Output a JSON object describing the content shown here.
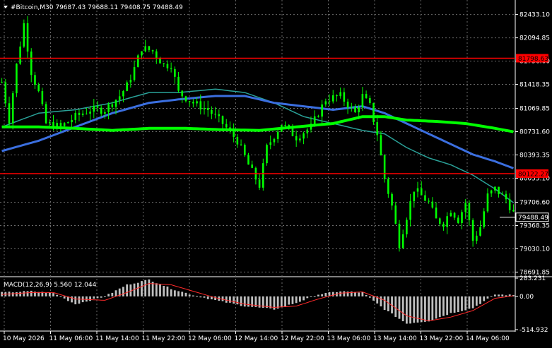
{
  "header": {
    "symbol_line": "#Bitcoin,M30  79687.43 79688.11 79408.75 79488.49"
  },
  "colors": {
    "background": "#000000",
    "candle": "#00ff00",
    "grid": "#6a6a6a",
    "axis_text": "#ffffff",
    "hline": "#ff0000",
    "hline_label_bg": "#ff0000",
    "ma_fast": "#2aa198",
    "ma_mid": "#3b6fe0",
    "ma_slow": "#00ff00",
    "macd_hist": "#c0c0c0",
    "macd_signal": "#ff2a2a",
    "price_label_bg": "#000000"
  },
  "chart_data": {
    "type": "candlestick",
    "title": "#Bitcoin,M30",
    "ohlc_last": {
      "open": 79687.43,
      "high": 79688.11,
      "low": 79408.75,
      "close": 79488.49
    },
    "y_ticks": [
      "82433.10",
      "82094.85",
      "81756.60",
      "81418.35",
      "81069.85",
      "80731.60",
      "80393.35",
      "80055.10",
      "79706.60",
      "79368.35",
      "79030.10",
      "78691.85"
    ],
    "ylim": [
      78645,
      82593
    ],
    "x_ticks": [
      "10 May 2026",
      "11 May 06:00",
      "11 May 14:00",
      "11 May 22:00",
      "12 May 06:00",
      "12 May 14:00",
      "12 May 22:00",
      "13 May 06:00",
      "13 May 14:00",
      "13 May 22:00",
      "14 May 06:00"
    ],
    "horizontal_lines": [
      {
        "label": "81798.63",
        "value": 81798.63
      },
      {
        "label": "80122.27",
        "value": 80122.27
      }
    ],
    "current_price_label": "79488.49",
    "current_price": 79488.49,
    "price_path": [
      [
        0,
        81450
      ],
      [
        2,
        80900
      ],
      [
        4,
        81700
      ],
      [
        6,
        82300
      ],
      [
        8,
        81600
      ],
      [
        10,
        81300
      ],
      [
        12,
        80850
      ],
      [
        16,
        80800
      ],
      [
        20,
        80950
      ],
      [
        24,
        81050
      ],
      [
        28,
        81050
      ],
      [
        32,
        81250
      ],
      [
        34,
        81400
      ],
      [
        36,
        81650
      ],
      [
        38,
        81950
      ],
      [
        41,
        81900
      ],
      [
        44,
        81700
      ],
      [
        46,
        81700
      ],
      [
        48,
        81300
      ],
      [
        52,
        81150
      ],
      [
        56,
        81050
      ],
      [
        60,
        80850
      ],
      [
        64,
        80600
      ],
      [
        67,
        80250
      ],
      [
        70,
        79950
      ],
      [
        72,
        80500
      ],
      [
        76,
        80850
      ],
      [
        80,
        80650
      ],
      [
        84,
        80800
      ],
      [
        88,
        81200
      ],
      [
        92,
        81250
      ],
      [
        96,
        81000
      ],
      [
        98,
        81250
      ],
      [
        100,
        81100
      ],
      [
        102,
        80700
      ],
      [
        104,
        80050
      ],
      [
        106,
        79650
      ],
      [
        108,
        79100
      ],
      [
        110,
        79500
      ],
      [
        112,
        79900
      ],
      [
        114,
        79800
      ],
      [
        116,
        79700
      ],
      [
        118,
        79450
      ],
      [
        120,
        79400
      ],
      [
        122,
        79600
      ],
      [
        124,
        79450
      ],
      [
        126,
        79700
      ],
      [
        128,
        79150
      ],
      [
        130,
        79350
      ],
      [
        132,
        79800
      ],
      [
        134,
        79900
      ],
      [
        137,
        79750
      ],
      [
        139,
        79550
      ]
    ],
    "ma_fast_path": [
      [
        0,
        80800
      ],
      [
        10,
        81000
      ],
      [
        20,
        81050
      ],
      [
        30,
        81150
      ],
      [
        40,
        81300
      ],
      [
        48,
        81300
      ],
      [
        58,
        81350
      ],
      [
        66,
        81300
      ],
      [
        74,
        81150
      ],
      [
        82,
        80950
      ],
      [
        90,
        80850
      ],
      [
        98,
        80750
      ],
      [
        104,
        80700
      ],
      [
        110,
        80500
      ],
      [
        116,
        80350
      ],
      [
        122,
        80250
      ],
      [
        128,
        80100
      ],
      [
        134,
        79900
      ],
      [
        139,
        79700
      ]
    ],
    "ma_mid_path": [
      [
        0,
        80450
      ],
      [
        10,
        80600
      ],
      [
        20,
        80800
      ],
      [
        30,
        81000
      ],
      [
        40,
        81150
      ],
      [
        48,
        81200
      ],
      [
        58,
        81250
      ],
      [
        66,
        81250
      ],
      [
        74,
        81150
      ],
      [
        82,
        81100
      ],
      [
        90,
        81050
      ],
      [
        98,
        81100
      ],
      [
        104,
        81000
      ],
      [
        110,
        80850
      ],
      [
        116,
        80700
      ],
      [
        122,
        80550
      ],
      [
        128,
        80400
      ],
      [
        134,
        80300
      ],
      [
        139,
        80200
      ]
    ],
    "ma_slow_path": [
      [
        0,
        80800
      ],
      [
        10,
        80800
      ],
      [
        20,
        80780
      ],
      [
        30,
        80750
      ],
      [
        40,
        80780
      ],
      [
        50,
        80780
      ],
      [
        60,
        80760
      ],
      [
        70,
        80750
      ],
      [
        80,
        80800
      ],
      [
        90,
        80850
      ],
      [
        98,
        80950
      ],
      [
        104,
        80950
      ],
      [
        110,
        80900
      ],
      [
        118,
        80880
      ],
      [
        126,
        80850
      ],
      [
        134,
        80780
      ],
      [
        139,
        80730
      ]
    ],
    "macd": {
      "label": "MACD(12,26,9) 5.560 12.044",
      "y_ticks": [
        "283.231",
        "0.00",
        "-514.932"
      ],
      "ylim": [
        -514.932,
        283.231
      ],
      "hist_path": [
        [
          0,
          60
        ],
        [
          8,
          80
        ],
        [
          14,
          50
        ],
        [
          20,
          -120
        ],
        [
          28,
          0
        ],
        [
          34,
          180
        ],
        [
          40,
          260
        ],
        [
          46,
          120
        ],
        [
          52,
          20
        ],
        [
          58,
          -60
        ],
        [
          66,
          -150
        ],
        [
          74,
          -200
        ],
        [
          80,
          -100
        ],
        [
          86,
          30
        ],
        [
          92,
          80
        ],
        [
          98,
          60
        ],
        [
          104,
          -200
        ],
        [
          110,
          -420
        ],
        [
          116,
          -380
        ],
        [
          122,
          -260
        ],
        [
          128,
          -180
        ],
        [
          134,
          30
        ],
        [
          139,
          20
        ]
      ],
      "signal_path": [
        [
          0,
          30
        ],
        [
          8,
          60
        ],
        [
          14,
          60
        ],
        [
          20,
          -40
        ],
        [
          28,
          -60
        ],
        [
          34,
          60
        ],
        [
          40,
          200
        ],
        [
          46,
          180
        ],
        [
          52,
          80
        ],
        [
          58,
          -20
        ],
        [
          66,
          -120
        ],
        [
          74,
          -170
        ],
        [
          80,
          -150
        ],
        [
          86,
          -40
        ],
        [
          92,
          50
        ],
        [
          98,
          70
        ],
        [
          104,
          -60
        ],
        [
          110,
          -300
        ],
        [
          116,
          -380
        ],
        [
          122,
          -320
        ],
        [
          128,
          -220
        ],
        [
          134,
          -30
        ],
        [
          139,
          10
        ]
      ]
    }
  }
}
